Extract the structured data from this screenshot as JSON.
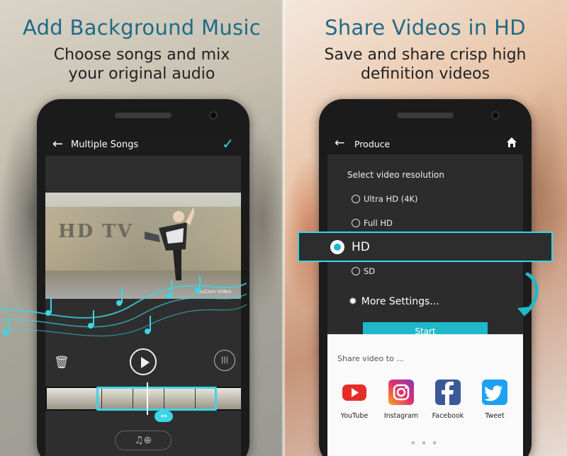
{
  "left": {
    "headline": "Add Background Music",
    "subline": "Choose songs and mix your original audio",
    "app_bar": {
      "title": "Multiple Songs",
      "back_icon": "arrow-left-icon",
      "confirm_icon": "checkmark-icon"
    },
    "video_watermark": "YouCam Video",
    "graffiti_text": "HD TV",
    "controls": {
      "delete_icon": "trash-icon",
      "play_icon": "play-icon",
      "wave_icon": "waveform-icon"
    },
    "add_music_glyph": "♫⊕",
    "accent": "#3bd6e6"
  },
  "right": {
    "headline": "Share Videos in HD",
    "subline": "Save and share crisp high definition videos",
    "app_bar": {
      "title": "Produce",
      "back_icon": "arrow-left-icon",
      "home_icon": "home-icon"
    },
    "resolution_label": "Select video resolution",
    "options": [
      "Ultra HD (4K)",
      "Full HD",
      "HD",
      "SD"
    ],
    "selected_option": "HD",
    "more_settings": "More Settings...",
    "start_label": "Start",
    "share_title": "Share video to ...",
    "share_targets": [
      {
        "label": "YouTube",
        "color": "#e52d27"
      },
      {
        "label": "Instagram",
        "color": "#c13584"
      },
      {
        "label": "Facebook",
        "color": "#3b5998"
      },
      {
        "label": "Tweet",
        "color": "#1da1f2"
      }
    ]
  }
}
